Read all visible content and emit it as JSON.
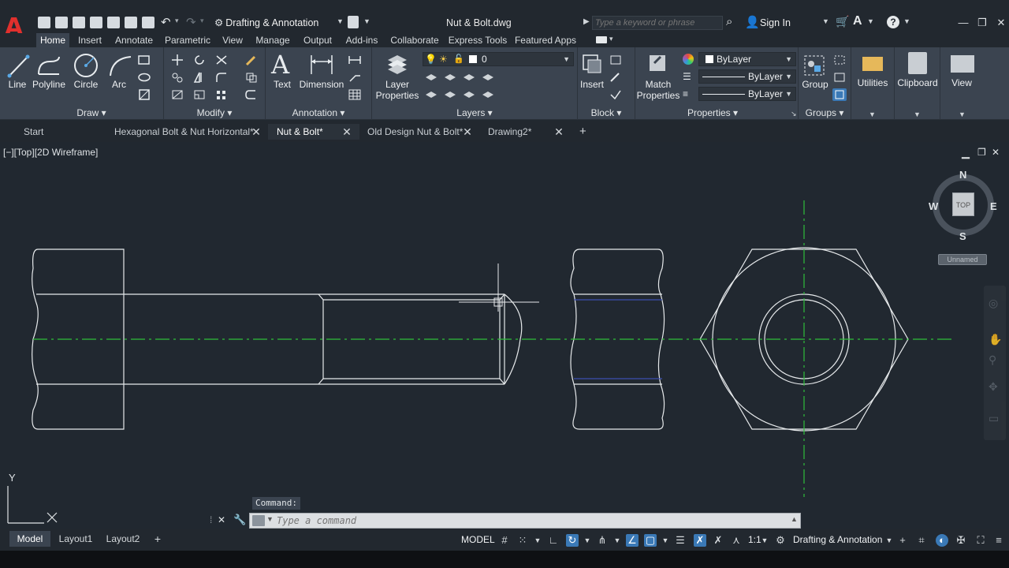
{
  "titlebar": {
    "workspace": "Drafting & Annotation",
    "file_title": "Nut & Bolt.dwg",
    "search_placeholder": "Type a keyword or phrase",
    "sign_in": "Sign In"
  },
  "ribbon_tabs": [
    "Home",
    "Insert",
    "Annotate",
    "Parametric",
    "View",
    "Manage",
    "Output",
    "Add-ins",
    "Collaborate",
    "Express Tools",
    "Featured Apps"
  ],
  "ribbon": {
    "draw": {
      "title": "Draw",
      "line": "Line",
      "polyline": "Polyline",
      "circle": "Circle",
      "arc": "Arc"
    },
    "modify": {
      "title": "Modify"
    },
    "annotation": {
      "title": "Annotation",
      "text": "Text",
      "dimension": "Dimension"
    },
    "layers": {
      "title": "Layers",
      "layer_properties_1": "Layer",
      "layer_properties_2": "Properties",
      "current_layer": "0"
    },
    "block": {
      "title": "Block",
      "insert": "Insert"
    },
    "properties": {
      "title": "Properties",
      "match_1": "Match",
      "match_2": "Properties",
      "color": "ByLayer",
      "linetype": "ByLayer",
      "lineweight": "ByLayer"
    },
    "groups": {
      "title": "Groups",
      "group": "Group"
    },
    "utilities": "Utilities",
    "clipboard": "Clipboard",
    "view": "View"
  },
  "doc_tabs": [
    {
      "label": "Start"
    },
    {
      "label": "Hexagonal Bolt & Nut Horizontal*"
    },
    {
      "label": "Nut & Bolt*"
    },
    {
      "label": "Old Design Nut & Bolt*"
    },
    {
      "label": "Drawing2*"
    }
  ],
  "viewport": {
    "label": "[−][Top][2D Wireframe]",
    "viewcube": {
      "face": "TOP",
      "north": "N",
      "south": "S",
      "east": "E",
      "west": "W",
      "ucs": "Unnamed"
    },
    "ucs_y": "Y"
  },
  "command": {
    "tooltip": "Command:",
    "placeholder": "Type a command"
  },
  "status": {
    "layout_tabs": [
      "Model",
      "Layout1",
      "Layout2"
    ],
    "model": "MODEL",
    "scale": "1:1",
    "workspace": "Drafting & Annotation"
  },
  "colors": {
    "background": "#212830",
    "ribbon": "#3b4450",
    "centerline": "#2fbf3a",
    "accent": "#3a79b6"
  }
}
